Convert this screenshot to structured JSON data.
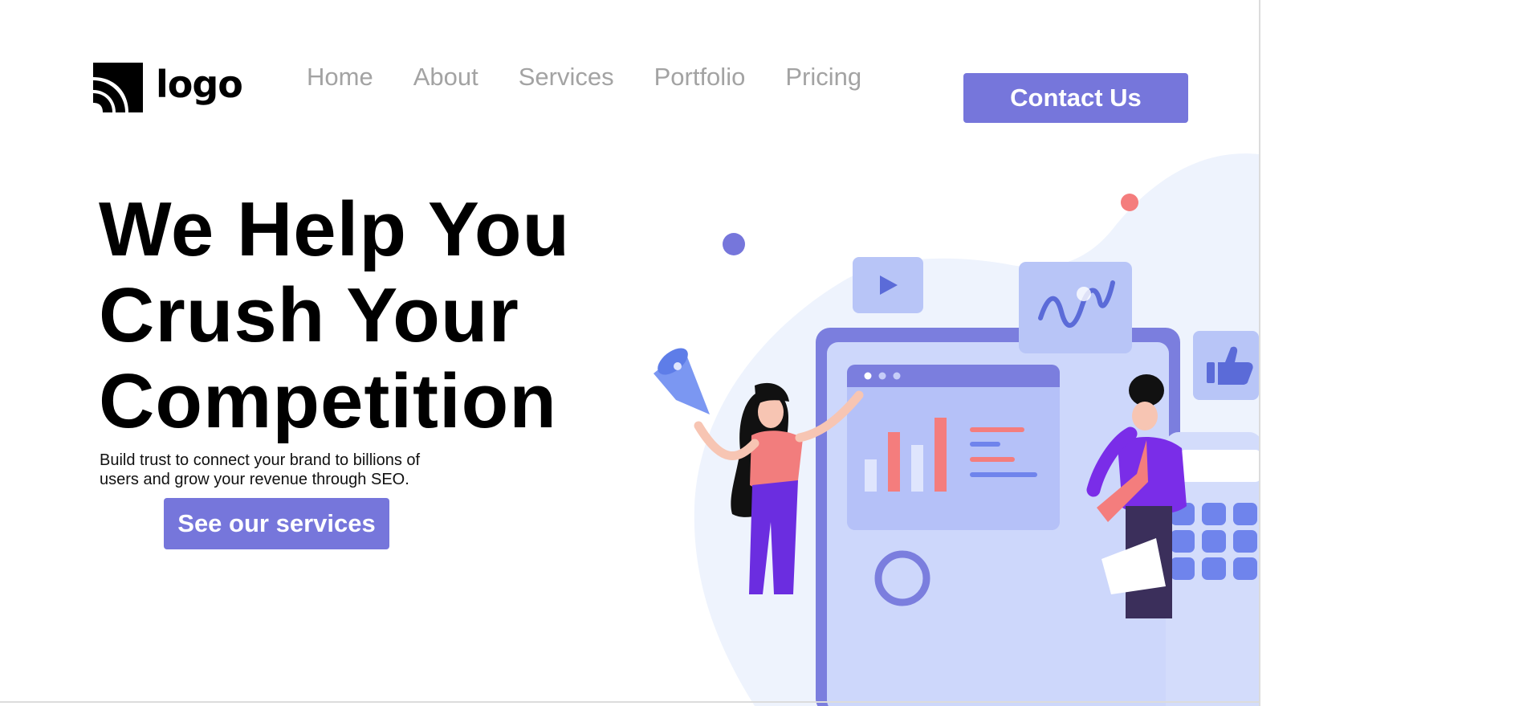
{
  "header": {
    "logo_text": "logo",
    "nav": [
      {
        "label": "Home"
      },
      {
        "label": "About"
      },
      {
        "label": "Services"
      },
      {
        "label": "Portfolio"
      },
      {
        "label": "Pricing"
      }
    ],
    "contact_label": "Contact Us"
  },
  "hero": {
    "title_lines": [
      "We Help You",
      "Crush Your",
      "Competition"
    ],
    "subtitle": "Build trust to connect your brand to billions of users and grow your revenue through SEO.",
    "cta_label": "See our services"
  },
  "colors": {
    "accent": "#7676db",
    "nav_text": "#a3a3a3",
    "blob": "#eef3fd",
    "coral": "#f47d7d"
  },
  "illustration": {
    "icons": [
      "play-icon",
      "trend-chart-icon",
      "thumbs-up-icon",
      "megaphone-icon",
      "calculator-icon"
    ]
  }
}
